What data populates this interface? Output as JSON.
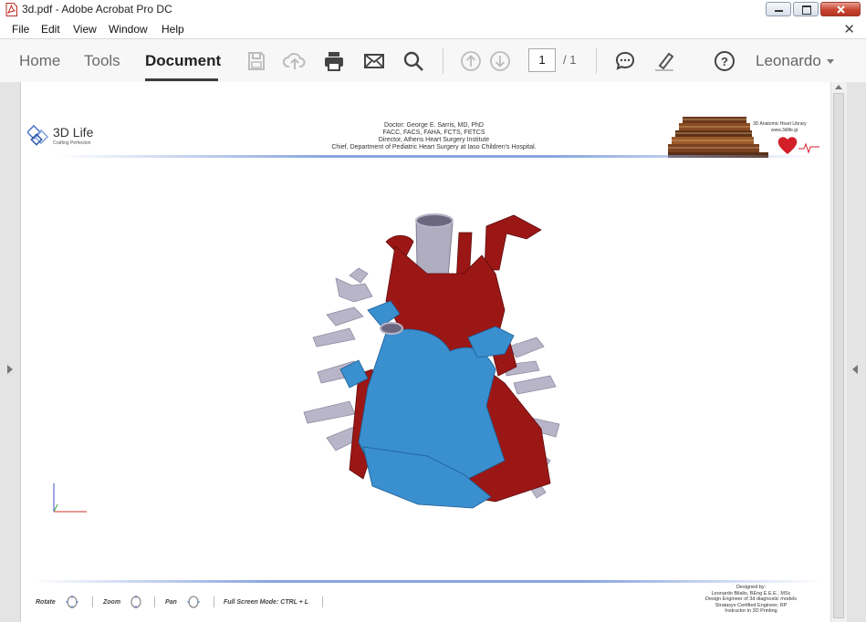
{
  "window": {
    "title": "3d.pdf - Adobe Acrobat Pro DC"
  },
  "menu": {
    "items": [
      "File",
      "Edit",
      "View",
      "Window",
      "Help"
    ]
  },
  "toolbar": {
    "tabs": [
      "Home",
      "Tools",
      "Document"
    ],
    "active_tab": "Document",
    "page_current": "1",
    "page_total": "/ 1",
    "user": "Leonardo"
  },
  "document": {
    "header": {
      "logo_text": "3D Life",
      "logo_tagline": "Crafting Perfection",
      "lines": [
        "Doctor: George E. Sarris, MD, PhD",
        "FACC, FACS, FAHA, FCTS, FETCS",
        "Director, Athens Heart Surgery Institute",
        "Chief, Department of Pediatric Heart Surgery at Iaso Children's Hospital."
      ],
      "library_title": "3D Anatomic Heart Library",
      "library_url": "www.3dlife.gr"
    },
    "footer": {
      "controls": [
        {
          "label": "Rotate"
        },
        {
          "label": "Zoom"
        },
        {
          "label": "Pan"
        },
        {
          "label": "Full Screen Mode:   CTRL + L"
        }
      ],
      "credits": [
        "Designed by:",
        "Leonardo Bilalis, BEng E.E.E., MSc",
        "Design Engineer of 3d diagnostic models",
        "Stratasys Certified Engineer, RP",
        "Instructor in 3D Printing"
      ]
    }
  },
  "colors": {
    "accent_red": "#9b1716",
    "vessel_blue": "#3a8fcf",
    "vessel_grey": "#b9b5c9",
    "header_line": "#8aa6df"
  }
}
